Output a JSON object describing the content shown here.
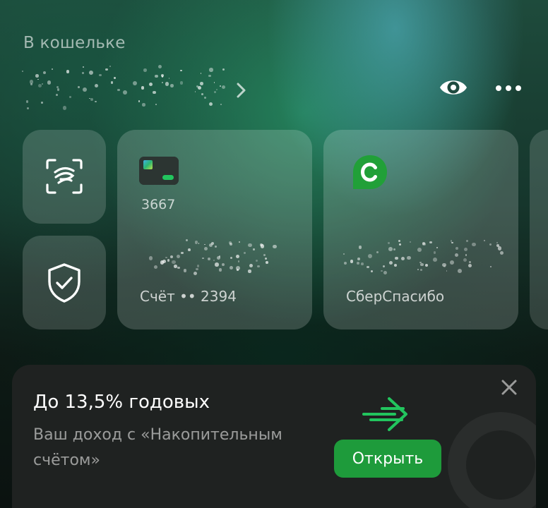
{
  "wallet": {
    "title": "В кошельке"
  },
  "header_actions": {
    "balance_chevron_icon": "chevron-right-icon",
    "visibility_icon": "eye-icon",
    "more_icon": "more-horizontal-icon"
  },
  "quick_tiles": [
    {
      "icon": "face-scan-icon"
    },
    {
      "icon": "shield-check-icon"
    }
  ],
  "cards": [
    {
      "number": "3667",
      "account": "Счёт •• 2394",
      "icon": "bank-card-icon"
    },
    {
      "label": "СберСпасибо",
      "icon": "sberspasibo-logo-icon"
    }
  ],
  "promo": {
    "title": "До 13,5% годовых",
    "description": "Ваш доход с «Накопительным счётом»",
    "button_label": "Открыть",
    "close_icon": "close-icon",
    "arrow_icon": "arrow-right-icon"
  },
  "colors": {
    "accent_green": "#1e9b3b",
    "promo_bg": "#1f2221",
    "tile_bg": "rgba(255,255,255,0.16)"
  }
}
